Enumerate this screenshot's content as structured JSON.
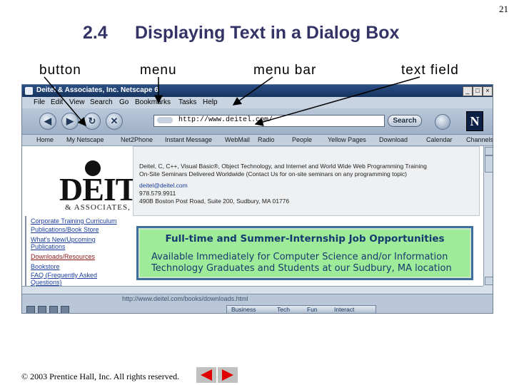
{
  "slide": {
    "number": "21",
    "section": "2.4",
    "title": "Displaying Text in a Dialog Box",
    "copyright": "© 2003 Prentice Hall, Inc. All rights reserved.",
    "callouts": {
      "button": "button",
      "menu": "menu",
      "menu_bar": "menu bar",
      "text_field": "text field"
    }
  },
  "browser": {
    "window_title": "Deitel & Associates, Inc.  Netscape 6",
    "window_buttons": [
      "_",
      "□",
      "×"
    ],
    "menu": [
      "File",
      "Edit",
      "View",
      "Search",
      "Go",
      "Bookmarks",
      "Tasks",
      "Help"
    ],
    "url": "http://www.deitel.com/",
    "search_label": "Search",
    "throbber": "N",
    "personal_toolbar": [
      "Home",
      "My Netscape",
      "Net2Phone",
      "Instant Message",
      "WebMail",
      "Radio",
      "People",
      "Yellow Pages",
      "Download",
      "Calendar",
      "Channels"
    ],
    "status_url": "http://www.deitel.com/books/downloads.html",
    "bottom_tabs": [
      "Business",
      "Tech",
      "Fun",
      "Interact"
    ]
  },
  "page": {
    "logo": "DEITEL",
    "logo_sub": "& ASSOCIATES, INC.",
    "info_lines": [
      "Deitel, C, C++, Visual Basic®, Object Technology, and Internet and World Wide Web Programming Training",
      "On-Site Seminars Delivered Worldwide (Contact Us for on-site seminars on any programming topic)",
      "deitel@deitel.com",
      "978.579.9911",
      "490B Boston Post Road, Suite 200, Sudbury, MA 01776"
    ],
    "left_links": [
      "Corporate Training Curriculum",
      "Publications/Book Store",
      "What's New/Upcoming",
      "Publications",
      "Downloads/Resources",
      "Bookstore",
      "FAQ (Frequently Asked",
      "Questions)"
    ],
    "job_title": "Full-time and Summer-Internship Job Opportunities",
    "job_line1": "Available Immediately for Computer Science and/or Information",
    "job_line2": "Technology Graduates and Students at our Sudbury, MA location"
  }
}
